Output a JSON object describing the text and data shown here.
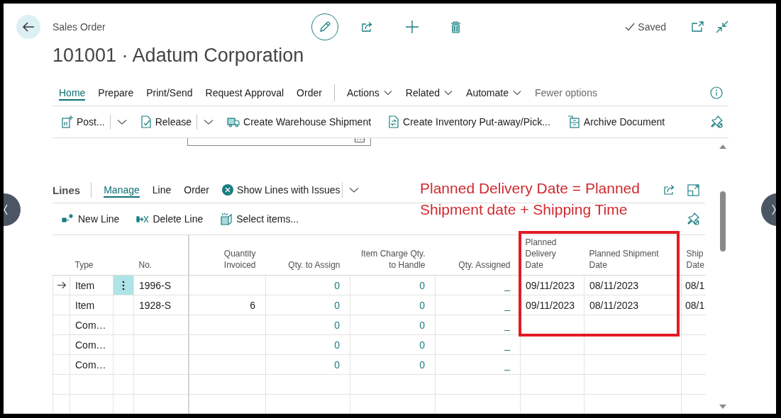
{
  "page": {
    "breadcrumb": "Sales Order",
    "title": "101001 · Adatum Corporation",
    "save_status": "Saved"
  },
  "action_bar": {
    "tabs": [
      {
        "label": "Home",
        "selected": true
      },
      {
        "label": "Prepare",
        "selected": false
      },
      {
        "label": "Print/Send",
        "selected": false
      },
      {
        "label": "Request Approval",
        "selected": false
      },
      {
        "label": "Order",
        "selected": false
      }
    ],
    "menus": [
      "Actions",
      "Related",
      "Automate"
    ],
    "fewer_options": "Fewer options",
    "promoted": [
      {
        "kind": "split",
        "label": "Post..."
      },
      {
        "kind": "split",
        "label": "Release"
      },
      {
        "kind": "plain",
        "label": "Create Warehouse Shipment"
      },
      {
        "kind": "plain",
        "label": "Create Inventory Put-away/Pick..."
      },
      {
        "kind": "plain",
        "label": "Archive Document"
      }
    ]
  },
  "lines": {
    "title": "Lines",
    "tabs": [
      {
        "label": "Manage",
        "selected": true
      },
      {
        "label": "Line",
        "selected": false
      },
      {
        "label": "Order",
        "selected": false
      }
    ],
    "issues_action": "Show Lines with Issues",
    "actions": [
      "New Line",
      "Delete Line",
      "Select items..."
    ],
    "table": {
      "columns": [
        "Type",
        "No.",
        "Quantity Invoiced",
        "Qty. to Assign",
        "Item Charge Qty. to Handle",
        "Qty. Assigned",
        "Planned Delivery Date",
        "Planned Shipment Date",
        "Ship Date"
      ],
      "rows": [
        {
          "selected": true,
          "type": "Item",
          "no": "1996-S",
          "qty_to_assign": "0",
          "item_charge_qty_to_handle": "0",
          "qty_assigned": "_",
          "planned_delivery_date": "09/11/2023",
          "planned_shipment_date": "08/11/2023",
          "column_9": "08/1"
        },
        {
          "selected": false,
          "type": "Item",
          "no": "1928-S",
          "quantity_invoiced": "6",
          "qty_to_assign": "0",
          "item_charge_qty_to_handle": "0",
          "qty_assigned": "_",
          "planned_delivery_date": "09/11/2023",
          "planned_shipment_date": "08/11/2023",
          "column_9": "08/1"
        },
        {
          "selected": false,
          "type": "Com…",
          "qty_to_assign": "0",
          "item_charge_qty_to_handle": "0",
          "qty_assigned": "_"
        },
        {
          "selected": false,
          "type": "Com…",
          "qty_to_assign": "0",
          "item_charge_qty_to_handle": "0",
          "qty_assigned": "_"
        },
        {
          "selected": false,
          "type": "Com…",
          "qty_to_assign": "0",
          "item_charge_qty_to_handle": "0",
          "qty_assigned": "_"
        },
        {
          "selected": false
        },
        {
          "selected": false
        }
      ]
    }
  },
  "annotation": {
    "note": "Planned Delivery Date = Planned Shipment date + Shipping Time"
  }
}
